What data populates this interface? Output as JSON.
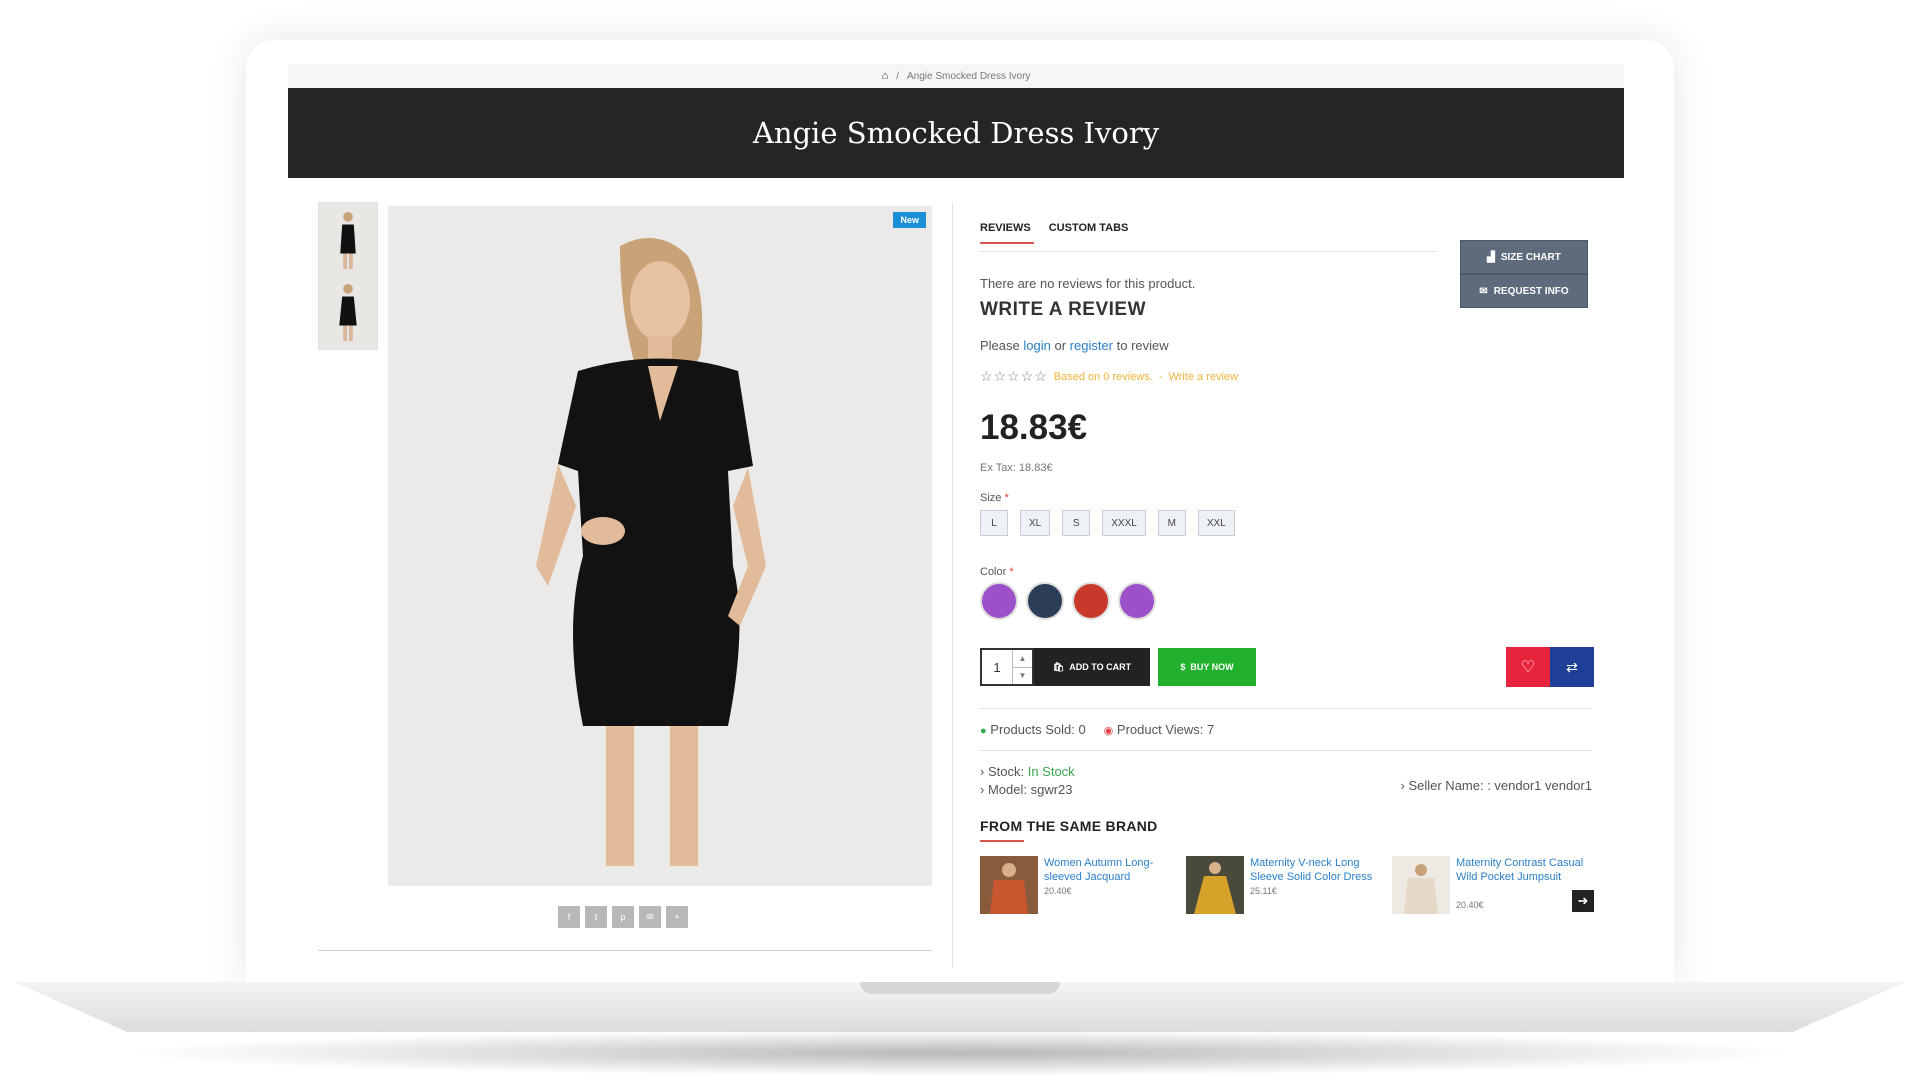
{
  "breadcrumb": {
    "home_icon": "home-icon",
    "separator": "/",
    "current": "Angie Smocked Dress Ivory"
  },
  "page_title": "Angie Smocked Dress Ivory",
  "product": {
    "badge": "New",
    "tabs": [
      {
        "label": "REVIEWS"
      },
      {
        "label": "CUSTOM TABS"
      }
    ],
    "side_buttons": {
      "size_chart": "SIZE CHART",
      "request_info": "REQUEST INFO"
    },
    "reviews": {
      "empty_text": "There are no reviews for this product.",
      "write_title": "WRITE A REVIEW",
      "please": "Please",
      "login": "login",
      "or": "or",
      "register": "register",
      "to_review": "to review",
      "stars": "☆☆☆☆☆",
      "based_on": "Based on 0 reviews.",
      "dash": "-",
      "write_link": "Write a review"
    },
    "price": "18.83€",
    "ex_tax": "Ex Tax: 18.83€",
    "size_label": "Size",
    "sizes": [
      "L",
      "XL",
      "S",
      "XXXL",
      "M",
      "XXL"
    ],
    "color_label": "Color",
    "required_mark": "*",
    "colors": [
      "#9b51c8",
      "#2c3e57",
      "#c8392b",
      "#9b51c8"
    ],
    "quantity": "1",
    "add_to_cart": "ADD TO CART",
    "buy_now": "BUY NOW",
    "products_sold": "Products Sold: 0",
    "product_views": "Product Views: 7",
    "stock_label": "Stock:",
    "stock_value": "In Stock",
    "model": "Model: sgwr23",
    "seller": "Seller Name: : vendor1 vendor1"
  },
  "brand": {
    "title": "FROM THE SAME BRAND",
    "items": [
      {
        "name": "Women Autumn Long-sleeved Jacquard",
        "price": "20.40€"
      },
      {
        "name": "Maternity V-neck Long Sleeve Solid Color Dress",
        "price": "25.11€"
      },
      {
        "name": "Maternity Contrast Casual Wild Pocket Jumpsuit",
        "price": "20.40€"
      }
    ]
  },
  "share_icons": [
    "facebook-icon",
    "twitter-icon",
    "pinterest-icon",
    "email-icon",
    "plus-icon"
  ]
}
